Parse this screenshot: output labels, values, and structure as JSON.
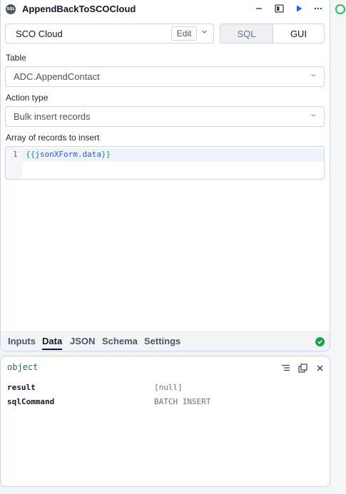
{
  "query": {
    "badge": "SQL",
    "title": "AppendBackToSCOCloud"
  },
  "header_icons": {
    "minimize": "minimize-icon",
    "split": "split-panel-icon",
    "run": "play-icon",
    "more": "more-icon"
  },
  "resource": {
    "name": "SCO Cloud",
    "edit_label": "Edit"
  },
  "mode": {
    "sql_label": "SQL",
    "gui_label": "GUI",
    "selected": "GUI"
  },
  "fields": {
    "table_label": "Table",
    "table_value": "ADC.AppendContact",
    "action_label": "Action type",
    "action_value": "Bulk insert records",
    "records_label": "Array of records to insert"
  },
  "code": {
    "line_number": "1",
    "open_brace": "{{",
    "expression": "jsonXForm.data",
    "close_brace": "}}"
  },
  "tabs": [
    {
      "label": "Inputs"
    },
    {
      "label": "Data"
    },
    {
      "label": "JSON"
    },
    {
      "label": "Schema"
    },
    {
      "label": "Settings"
    }
  ],
  "active_tab": "Data",
  "result": {
    "type_label": "object",
    "rows": [
      {
        "key": "result",
        "value": "[null]"
      },
      {
        "key": "sqlCommand",
        "value": "BATCH INSERT"
      }
    ]
  },
  "colors": {
    "accent": "#2563eb",
    "success": "#16a34a",
    "panel_border": "#c7d2f5"
  }
}
